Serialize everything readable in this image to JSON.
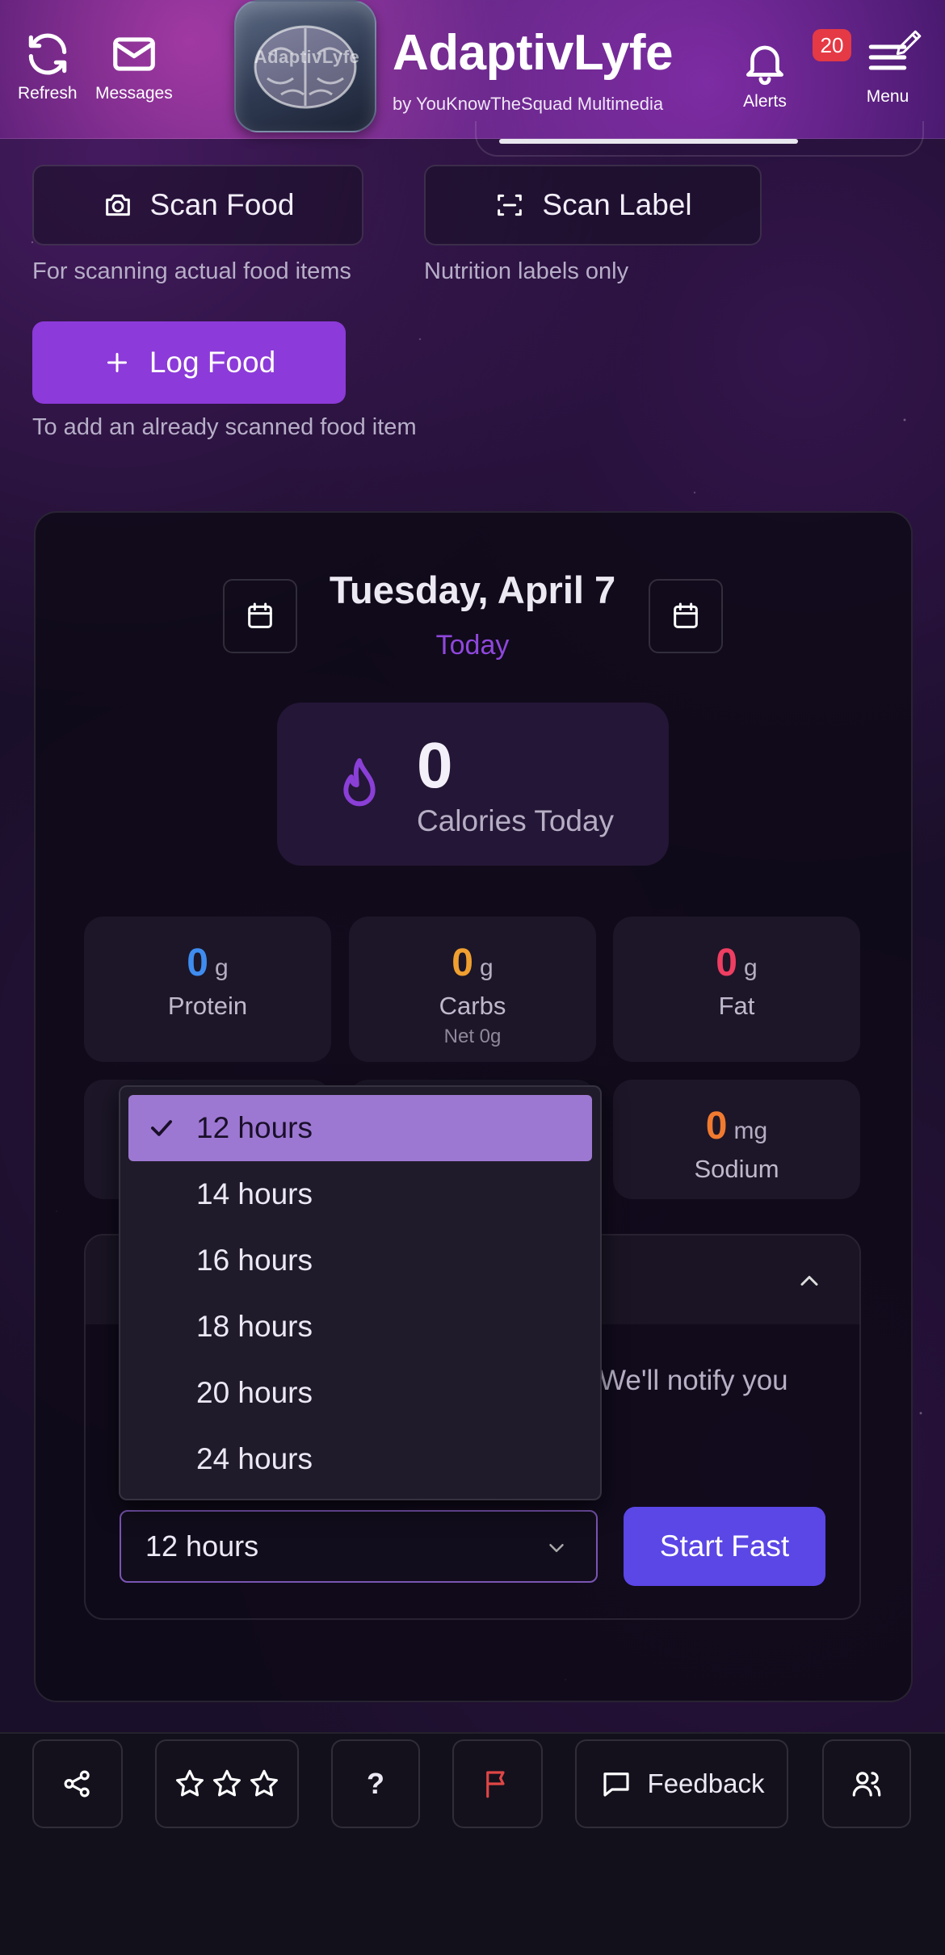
{
  "header": {
    "refresh_label": "Refresh",
    "messages_label": "Messages",
    "logo_text": "AdaptivLyfe",
    "app_title": "AdaptivLyfe",
    "app_subtitle": "by YouKnowTheSquad Multimedia",
    "alerts_label": "Alerts",
    "alerts_count": "20",
    "menu_label": "Menu"
  },
  "scan": {
    "scan_food_label": "Scan Food",
    "scan_food_hint": "For scanning actual food items",
    "scan_label_label": "Scan Label",
    "scan_label_hint": "Nutrition labels only"
  },
  "log_food": {
    "label": "Log Food",
    "hint": "To add an already scanned food item"
  },
  "day": {
    "date": "Tuesday, April 7",
    "relative": "Today",
    "calories_value": "0",
    "calories_label": "Calories Today"
  },
  "nutrients": [
    {
      "value": "0",
      "unit": "g",
      "name": "Protein",
      "color": "#3f8cf0"
    },
    {
      "value": "0",
      "unit": "g",
      "name": "Carbs",
      "sub": "Net 0g",
      "color": "#f0a030"
    },
    {
      "value": "0",
      "unit": "g",
      "name": "Fat",
      "color": "#ee3e62"
    },
    {
      "value": "0",
      "unit": "mg",
      "name": "Sodium",
      "color": "#f07a30"
    }
  ],
  "fasting": {
    "notify_text": "We'll notify you",
    "selected_duration": "12 hours",
    "start_label": "Start Fast",
    "options": [
      "12 hours",
      "14 hours",
      "16 hours",
      "18 hours",
      "20 hours",
      "24 hours"
    ]
  },
  "footer": {
    "help_label": "?",
    "feedback_label": "Feedback"
  },
  "colors": {
    "accent_purple": "#8c3ad9",
    "start_button": "#5b46e6",
    "selected_option": "#9d78d2",
    "badge": "#e53945"
  }
}
